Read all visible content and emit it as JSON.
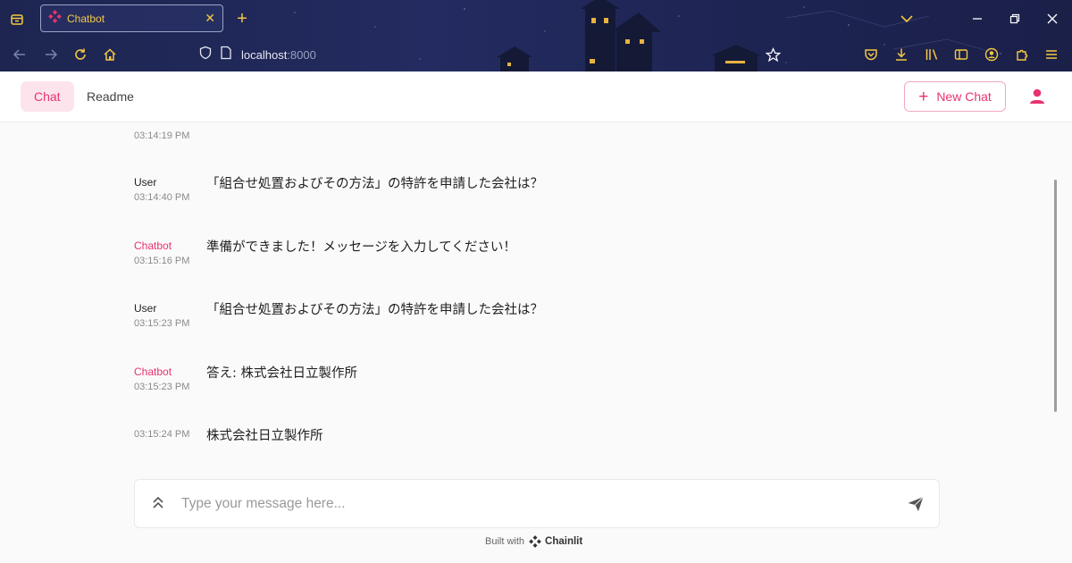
{
  "browser": {
    "tab_title": "Chatbot",
    "tab_close": "✕",
    "new_tab": "+",
    "url_host": "localhost",
    "url_port": ":8000",
    "accent": "#f5c842"
  },
  "header": {
    "nav": [
      {
        "label": "Chat",
        "active": true
      },
      {
        "label": "Readme",
        "active": false
      }
    ],
    "new_chat_label": "New Chat",
    "new_chat_icon": "+",
    "accent": "#e8336e"
  },
  "messages": [
    {
      "author": "",
      "time": "03:14:19 PM",
      "text": ""
    },
    {
      "author": "User",
      "time": "03:14:40 PM",
      "text": "「組合せ処置およびその方法」の特許を申請した会社は？"
    },
    {
      "author": "Chatbot",
      "time": "03:15:16 PM",
      "text": "準備ができました！メッセージを入力してください！"
    },
    {
      "author": "User",
      "time": "03:15:23 PM",
      "text": "「組合せ処置およびその方法」の特許を申請した会社は？"
    },
    {
      "author": "Chatbot",
      "time": "03:15:23 PM",
      "text": "答え: 株式会社日立製作所"
    },
    {
      "author": "",
      "time": "03:15:24 PM",
      "text": "株式会社日立製作所"
    }
  ],
  "composer": {
    "placeholder": "Type your message here..."
  },
  "footer": {
    "built_with": "Built with",
    "brand": "Chainlit"
  }
}
